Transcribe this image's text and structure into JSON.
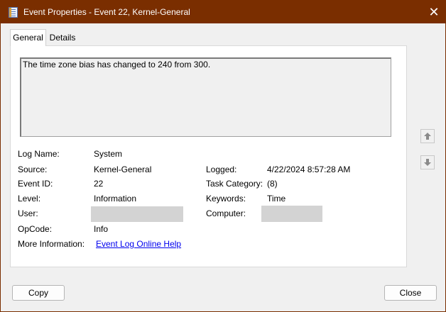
{
  "window": {
    "title": "Event Properties - Event 22, Kernel-General",
    "close_glyph": "✕"
  },
  "tabs": [
    {
      "label": "General",
      "active": true
    },
    {
      "label": "Details",
      "active": false
    }
  ],
  "description": "The time zone bias has changed to 240 from 300.",
  "fields": {
    "log_name": {
      "label": "Log Name:",
      "value": "System"
    },
    "source": {
      "label": "Source:",
      "value": "Kernel-General"
    },
    "logged": {
      "label": "Logged:",
      "value": "4/22/2024 8:57:28 AM"
    },
    "event_id": {
      "label": "Event ID:",
      "value": "22"
    },
    "task_category": {
      "label": "Task Category:",
      "value": "(8)"
    },
    "level": {
      "label": "Level:",
      "value": "Information"
    },
    "keywords": {
      "label": "Keywords:",
      "value": "Time"
    },
    "user": {
      "label": "User:",
      "value": ""
    },
    "computer": {
      "label": "Computer:",
      "value": ""
    },
    "opcode": {
      "label": "OpCode:",
      "value": "Info"
    },
    "more_info": {
      "label": "More Information:",
      "link_text": "Event Log Online Help"
    }
  },
  "buttons": {
    "copy": "Copy",
    "close": "Close"
  },
  "colors": {
    "titlebar": "#7a2e00",
    "link": "#0000ee",
    "redaction": "#d3d3d3"
  },
  "icons": {
    "window": "event-viewer-icon",
    "previous": "arrow-up-icon",
    "next": "arrow-down-icon"
  }
}
